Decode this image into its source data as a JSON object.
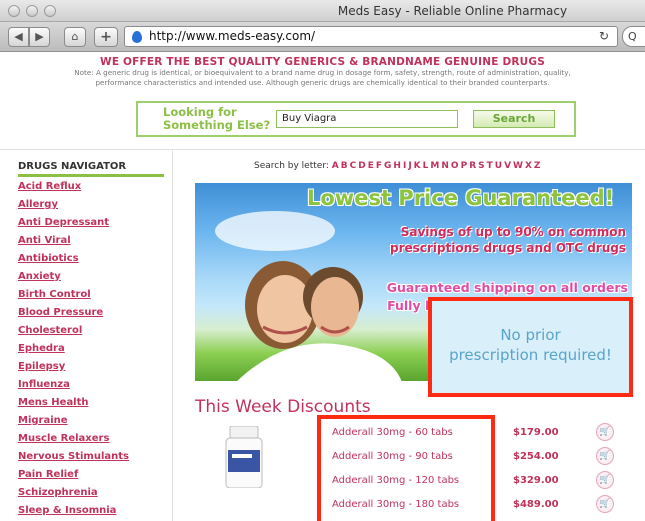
{
  "browser": {
    "title": "Meds Easy - Reliable Online Pharmacy",
    "url": "http://www.meds-easy.com/",
    "search_hint": "Q"
  },
  "header": {
    "offer": "WE OFFER THE BEST QUALITY GENERICS & BRANDNAME GENUINE DRUGS",
    "note_line1": "Note: A generic drug is identical, or bioequivalent to a brand name drug in dosage form, safety, strength, route of administration, quality,",
    "note_line2": "performance characteristics and intended use. Although generic drugs are chemically identical to their branded counterparts."
  },
  "search": {
    "label_line1": "Looking for",
    "label_line2": "Something Else?",
    "value": "Buy Viagra",
    "button": "Search"
  },
  "sidebar": {
    "title": "DRUGS NAVIGATOR",
    "items": [
      "Acid Reflux",
      "Allergy",
      "Anti Depressant",
      "Anti Viral",
      "Antibiotics",
      "Anxiety",
      "Birth Control",
      "Blood Pressure",
      "Cholesterol",
      "Ephedra",
      "Epilepsy",
      "Influenza",
      "Mens Health",
      "Migraine",
      "Muscle Relaxers",
      "Nervous Stimulants",
      "Pain Relief",
      "Schizophrenia",
      "Sleep & Insomnia"
    ]
  },
  "letters": {
    "label": "Search by letter:",
    "list": [
      "A",
      "B",
      "C",
      "D",
      "E",
      "F",
      "G",
      "H",
      "I",
      "J",
      "K",
      "L",
      "M",
      "N",
      "O",
      "P",
      "R",
      "S",
      "T",
      "U",
      "V",
      "W",
      "X",
      "Z"
    ]
  },
  "banner": {
    "headline": "Lowest Price Guaranteed!",
    "sub_line1": "Savings of up to 90% on common",
    "sub_line2": "prescriptions drugs and OTC drugs",
    "ship_line1": "Guaranteed shipping on all orders",
    "ship_line2": "Fully licensed approved pharmacy"
  },
  "callout": {
    "line1": "No prior",
    "line2": "prescription required!"
  },
  "discounts": {
    "title": "This Week Discounts",
    "rows": [
      {
        "name": "Adderall 30mg - 60 tabs",
        "price": "$179.00"
      },
      {
        "name": "Adderall 30mg - 90 tabs",
        "price": "$254.00"
      },
      {
        "name": "Adderall 30mg - 120 tabs",
        "price": "$329.00"
      },
      {
        "name": "Adderall 30mg - 180 tabs",
        "price": "$489.00"
      }
    ]
  },
  "colors": {
    "brand_pink": "#c0325c",
    "brand_green": "#8cc043",
    "highlight_red": "#ff2a12"
  }
}
